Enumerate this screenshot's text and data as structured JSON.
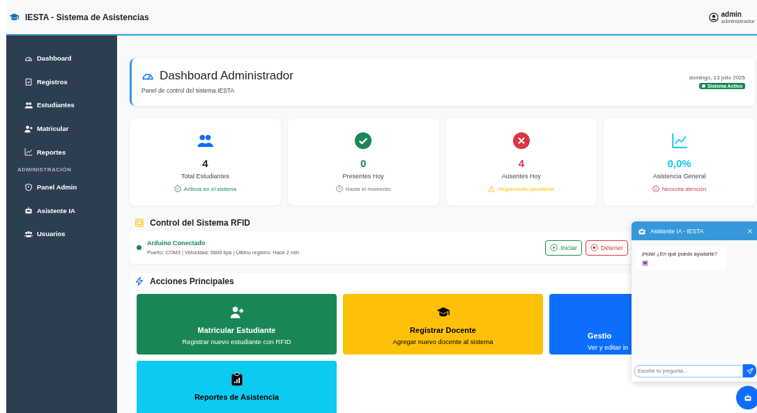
{
  "navbar": {
    "brand": "IESTA - Sistema de Asistencias",
    "user": {
      "name": "admin",
      "role": "administrador"
    }
  },
  "sidebar": {
    "items": [
      {
        "kind": "item",
        "label": "Dashboard",
        "selected": false
      },
      {
        "kind": "item",
        "label": "Registros",
        "selected": false
      },
      {
        "kind": "item",
        "label": "Estudiantes",
        "selected": false
      },
      {
        "kind": "item",
        "label": "Matricular",
        "selected": false
      },
      {
        "kind": "item",
        "label": "Reportes",
        "selected": false
      },
      {
        "kind": "heading",
        "label": "ADMINISTRACIÓN"
      },
      {
        "kind": "item",
        "label": "Panel Admin",
        "selected": false
      },
      {
        "kind": "item",
        "label": "Asistente IA",
        "selected": false
      },
      {
        "kind": "item",
        "label": "Usuarios",
        "selected": false
      }
    ]
  },
  "header": {
    "title": "Dashboard Administrador",
    "subtitle": "Panel de control del sistema IESTA",
    "date": "domingo, 13 julio 2025",
    "status": "Sistema Activo"
  },
  "stats": [
    {
      "value": "4",
      "label": "Total Estudiantes",
      "note": "Activos en el sistema",
      "color": "#0d6efd"
    },
    {
      "value": "0",
      "label": "Presentes Hoy",
      "note": "Hasta el momento",
      "color": "#198754"
    },
    {
      "value": "4",
      "label": "Ausentes Hoy",
      "note": "Seguimiento pendiente",
      "color": "#dc3545"
    },
    {
      "value": "0,0%",
      "label": "Asistencia General",
      "note": "Necesita atención",
      "color": "#0dcaf0"
    }
  ],
  "rfid": {
    "title": "Control del Sistema RFID",
    "device": "Arduino Conectado",
    "details": "Puerto: COM3 | Velocidad: 9600 bps | Último registro: Hace 2 min",
    "buttons": [
      "Iniciar",
      "Detener"
    ]
  },
  "actions": {
    "title": "Acciones Principales",
    "cards": [
      {
        "title": "Matricular Estudiante",
        "subtitle": "Registrar nuevo estudiante con RFID",
        "color": "#198754"
      },
      {
        "title": "Registrar Docente",
        "subtitle": "Agregar nuevo docente al sistema",
        "color": "#ffc107"
      },
      {
        "title": "Gestio",
        "subtitle": "Ver y editar in",
        "color": "#0d6efd"
      },
      {
        "title": "Reportes de Asistencia",
        "color": "#0dcaf0"
      }
    ]
  },
  "chat": {
    "title": "Asistente IA - IESTA",
    "messages": [
      {
        "text": "¡Hola! ¿En qué puedo ayudarte?"
      }
    ],
    "input": {
      "placeholder": "Escribe tu pregunta..."
    }
  }
}
